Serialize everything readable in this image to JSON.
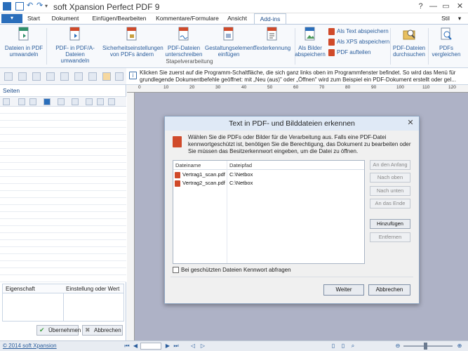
{
  "window": {
    "title": "soft Xpansion Perfect PDF 9",
    "style_label": "Stil"
  },
  "tabs": [
    {
      "label": "Start"
    },
    {
      "label": "Dokument"
    },
    {
      "label": "Einfügen/Bearbeiten"
    },
    {
      "label": "Kommentare/Formulare"
    },
    {
      "label": "Ansicht"
    },
    {
      "label": "Add-ins"
    }
  ],
  "ribbon": {
    "buttons": [
      {
        "label1": "Dateien in PDF",
        "label2": "umwandeln"
      },
      {
        "label1": "PDF- in PDF/A-Dateien",
        "label2": "umwandeln"
      },
      {
        "label1": "Sicherheitseinstellungen",
        "label2": "von PDFs ändern"
      },
      {
        "label1": "PDF-Dateien",
        "label2": "unterschreiben"
      },
      {
        "label1": "Gestaltungselement",
        "label2": "einfügen"
      },
      {
        "label1": "Texterkennung",
        "label2": ""
      },
      {
        "label1": "Als Bilder",
        "label2": "abspeichern"
      },
      {
        "label1": "PDF-Dateien",
        "label2": "durchsuchen"
      },
      {
        "label1": "PDFs",
        "label2": "vergleichen"
      }
    ],
    "small": [
      "Als Text abspeichern",
      "Als XPS abspeichern",
      "PDF aufteilen"
    ],
    "group_label": "Stapelverarbeitung"
  },
  "infobar": {
    "text": "Klicken Sie zuerst auf die Programm-Schaltfläche, die sich ganz links oben im Programmfenster befindet. So wird das Menü für grundlegende Dokumentbefehle geöffnet: mit „Neu (aus)\" oder „Öffnen\" wird zum Beispiel ein PDF-Dokument erstellt oder gel..."
  },
  "leftpanel": {
    "title": "Seiten",
    "prop_col1": "Eigenschaft",
    "prop_col2": "Einstellung oder Wert",
    "apply_label": "Übernehmen",
    "cancel_label": "Abbrechen"
  },
  "ruler": {
    "ticks": [
      "0",
      "10",
      "20",
      "30",
      "40",
      "50",
      "60",
      "70",
      "80",
      "90",
      "100",
      "110",
      "120"
    ]
  },
  "dialog": {
    "title": "Text in PDF- und Bilddateien erkennen",
    "message": "Wählen Sie die PDFs oder Bilder für die Verarbeitung aus. Falls eine PDF-Datei kennwortgeschützt ist, benötigen Sie die Berechtigung, das Dokument zu bearbeiten oder Sie müssen das Besitzerkennwort eingeben, um die Datei zu öffnen.",
    "col_name": "Dateiname",
    "col_path": "Dateipfad",
    "files": [
      {
        "name": "Vertrag1_scan.pdf",
        "path": "C:\\Netbox"
      },
      {
        "name": "Vertrag2_scan.pdf",
        "path": "C:\\Netbox"
      }
    ],
    "side_buttons": {
      "to_start": "An den Anfang",
      "up": "Nach oben",
      "down": "Nach unten",
      "to_end": "An das Ende",
      "add": "Hinzufügen",
      "remove": "Entfernen"
    },
    "checkbox_label": "Bei geschützten Dateien Kennwort abfragen",
    "next_label": "Weiter",
    "cancel_label": "Abbrechen"
  },
  "status": {
    "copyright": "© 2014 soft Xpansion"
  },
  "colors": {
    "accent": "#2a6ebb",
    "canvas": "#aeb2c6",
    "pdf_icon": "#d04a2a"
  }
}
